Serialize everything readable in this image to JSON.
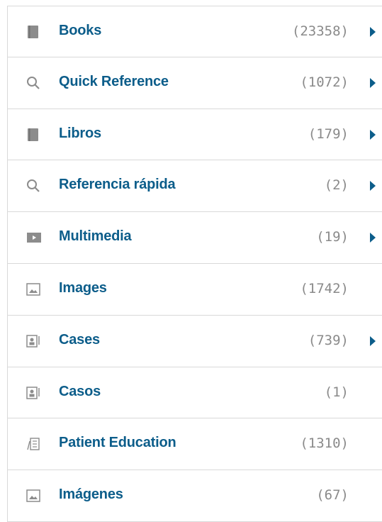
{
  "colors": {
    "link": "#0c5d8a",
    "count": "#8a8a8a",
    "icon": "#8c8c8c",
    "divider": "#d9d9d9"
  },
  "items": [
    {
      "icon": "book-icon",
      "label": "Books",
      "count": "(23358)",
      "expandable": true
    },
    {
      "icon": "search-icon",
      "label": "Quick Reference",
      "count": "(1072)",
      "expandable": true
    },
    {
      "icon": "book-icon",
      "label": "Libros",
      "count": "(179)",
      "expandable": true
    },
    {
      "icon": "search-icon",
      "label": "Referencia rápida",
      "count": "(2)",
      "expandable": true
    },
    {
      "icon": "video-icon",
      "label": "Multimedia",
      "count": "(19)",
      "expandable": true
    },
    {
      "icon": "image-icon",
      "label": "Images",
      "count": "(1742)",
      "expandable": false
    },
    {
      "icon": "case-icon",
      "label": "Cases",
      "count": "(739)",
      "expandable": true
    },
    {
      "icon": "case-icon",
      "label": "Casos",
      "count": "(1)",
      "expandable": false
    },
    {
      "icon": "patient-education-icon",
      "label": "Patient Education",
      "count": "(1310)",
      "expandable": false
    },
    {
      "icon": "image-icon",
      "label": "Imágenes",
      "count": "(67)",
      "expandable": false
    }
  ]
}
